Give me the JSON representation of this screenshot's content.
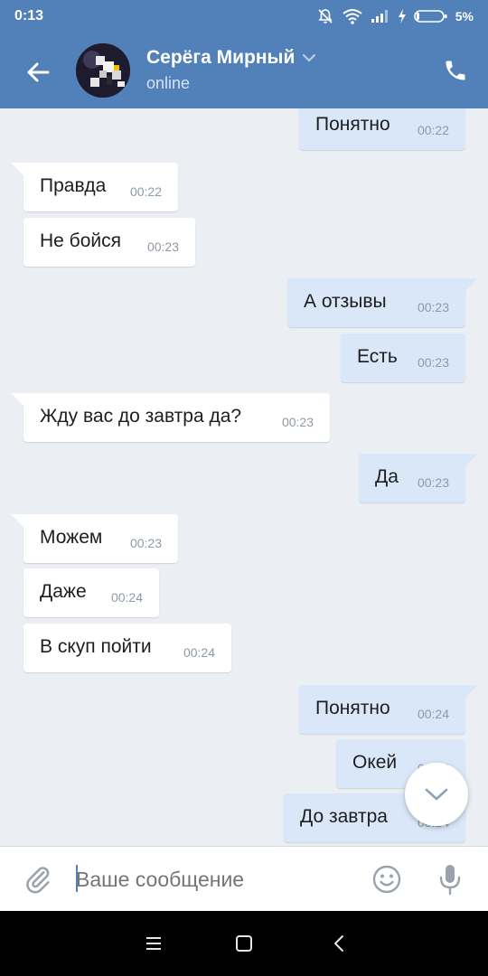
{
  "status_bar": {
    "time": "0:13",
    "battery": "5%"
  },
  "header": {
    "name": "Серёга Мирный",
    "status": "online"
  },
  "messages": [
    {
      "dir": "out",
      "text": "Понятно",
      "time": "00:22"
    },
    {
      "dir": "in",
      "text": "Правда",
      "time": "00:22"
    },
    {
      "dir": "in",
      "text": "Не бойся",
      "time": "00:23"
    },
    {
      "dir": "out",
      "text": "А отзывы",
      "time": "00:23"
    },
    {
      "dir": "out",
      "text": "Есть",
      "time": "00:23"
    },
    {
      "dir": "in",
      "text": "Жду вас до завтра да?",
      "time": "00:23"
    },
    {
      "dir": "out",
      "text": "Да",
      "time": "00:23"
    },
    {
      "dir": "in",
      "text": "Можем",
      "time": "00:23"
    },
    {
      "dir": "in",
      "text": "Даже",
      "time": "00:24"
    },
    {
      "dir": "in",
      "text": "В скуп пойти",
      "time": "00:24"
    },
    {
      "dir": "out",
      "text": "Понятно",
      "time": "00:24"
    },
    {
      "dir": "out",
      "text": "Окей",
      "time": "00:24"
    },
    {
      "dir": "out",
      "text": "До завтра",
      "time": "00:24"
    }
  ],
  "composer": {
    "placeholder": "Ваше сообщение"
  },
  "icons": {
    "back": "arrow-left-icon",
    "call": "phone-icon",
    "attach": "paperclip-icon",
    "emoji": "smiley-icon",
    "mic": "microphone-icon",
    "scroll_down": "chevron-down-icon"
  },
  "colors": {
    "accent": "#5181b8",
    "incoming_bubble": "#ffffff",
    "outgoing_bubble": "#d9e7f9",
    "background": "#ebeff4"
  }
}
